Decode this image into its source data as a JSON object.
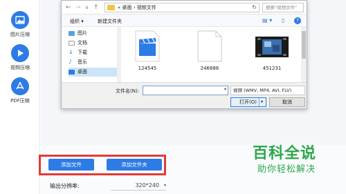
{
  "sidebar": {
    "items": [
      {
        "label": "图片压缩",
        "icon": "image-icon"
      },
      {
        "label": "视频压缩",
        "icon": "play-icon"
      },
      {
        "label": "PDF压缩",
        "icon": "pdf-icon"
      }
    ]
  },
  "dialog": {
    "breadcrumb": "« 桌面 › 视频文件",
    "search_placeholder": "搜索\"视频文件\"",
    "toolbar": {
      "organize": "组织 ▾",
      "new_folder": "新建文件夹"
    },
    "nav_items": [
      {
        "label": "图片",
        "icon": "pictures-icon"
      },
      {
        "label": "文档",
        "icon": "documents-icon"
      },
      {
        "label": "下载",
        "icon": "downloads-icon"
      },
      {
        "label": "音乐",
        "icon": "music-icon"
      },
      {
        "label": "桌面",
        "icon": "desktop-icon"
      }
    ],
    "files": [
      {
        "name": "124545",
        "type": "video-file"
      },
      {
        "name": "246886",
        "type": "blank-file"
      },
      {
        "name": "451231",
        "type": "video-thumbnail"
      }
    ],
    "filename_label": "文件名(N):",
    "filename_value": "",
    "filter_value": "视频 (WMV, MP4, AVI, FLV)",
    "open_label": "打开(O)",
    "cancel_label": "取消"
  },
  "actions": {
    "add_file": "添加文件",
    "add_folder": "添加文件夹"
  },
  "resolution": {
    "label": "输出分辨率:",
    "value": "320*240"
  },
  "watermark": {
    "title": "百科全说",
    "subtitle": "助你轻松解决"
  },
  "colors": {
    "accent": "#2d7be5",
    "highlight": "#e53935",
    "watermark": "#2aa84a"
  }
}
